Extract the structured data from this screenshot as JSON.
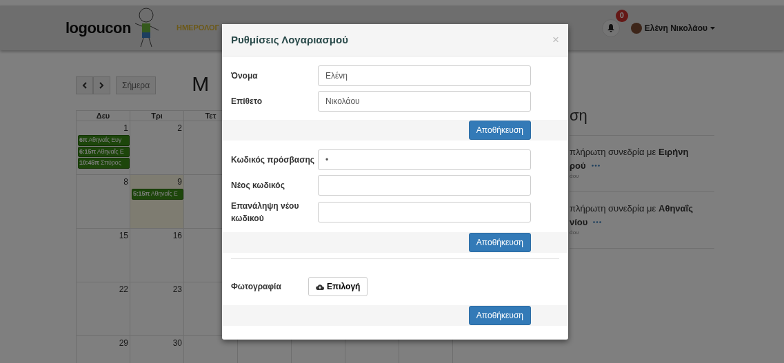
{
  "navbar": {
    "logo": "logoucon",
    "nav_items": [
      {
        "label": "ΗΜΕΡΟΛΟΓ",
        "selected": true
      }
    ],
    "notifications": {
      "count": "0"
    },
    "user": {
      "name": "Ελένη Νικολάου"
    }
  },
  "calendar": {
    "today_button": "Σήμερα",
    "title": "Μ",
    "weekdays": [
      "Δευ",
      "Τρι",
      "Τετ"
    ],
    "weeks": [
      [
        {
          "day": "1",
          "highlighted": false,
          "events": [
            "**6π** Αθηναΐς Ευγ",
            "**6:15π** Αθηναΐς Ε",
            "**10:45π** Σπύρος"
          ]
        },
        {
          "day": "2",
          "highlighted": false
        }
      ],
      [
        {
          "day": "8",
          "highlighted": false
        },
        {
          "day": "9",
          "highlighted": true,
          "events": [
            "**5:15π** Αθηναΐς Ε"
          ]
        }
      ],
      [
        {
          "day": "15",
          "highlighted": false
        },
        {
          "day": "16",
          "highlighted": false
        }
      ],
      [
        {
          "day": "22",
          "highlighted": false
        },
        {
          "day": "23",
          "highlighted": false
        }
      ],
      [
        {
          "day": "29",
          "highlighted": false
        },
        {
          "day": "30",
          "highlighted": false
        }
      ]
    ]
  },
  "feed": {
    "heading": "ση",
    "items": [
      {
        "line1": "πλήρωτη συνεδρία με **Ειρήνη**",
        "line2": "ρού",
        "meta": "άου"
      },
      {
        "line1": "πλήρωτη συνεδρία με **Αθηναΐς**",
        "line2": "νίου",
        "meta": "άου"
      }
    ]
  },
  "modal": {
    "title": "Ρυθμίσεις Λογαριασμού",
    "close": "×",
    "sections": [
      {
        "fields": [
          {
            "kind": "text",
            "label": "Όνομα",
            "value": "Ελένη"
          },
          {
            "kind": "text",
            "label": "Επίθετο",
            "value": "Νικολάου"
          }
        ],
        "button": "Αποθήκευση"
      },
      {
        "fields": [
          {
            "kind": "text",
            "label": "Κωδικός πρόσβασης",
            "value": "•"
          },
          {
            "kind": "text",
            "label": "Νέος κωδικός"
          },
          {
            "kind": "text",
            "label": "Επανάληψη νέου κωδικού"
          }
        ],
        "button": "Αποθήκευση"
      },
      {
        "fields": [
          {
            "kind": "file",
            "label": "Φωτογραφία",
            "value": "Επιλογή"
          }
        ],
        "button": "Αποθήκευση"
      }
    ]
  }
}
